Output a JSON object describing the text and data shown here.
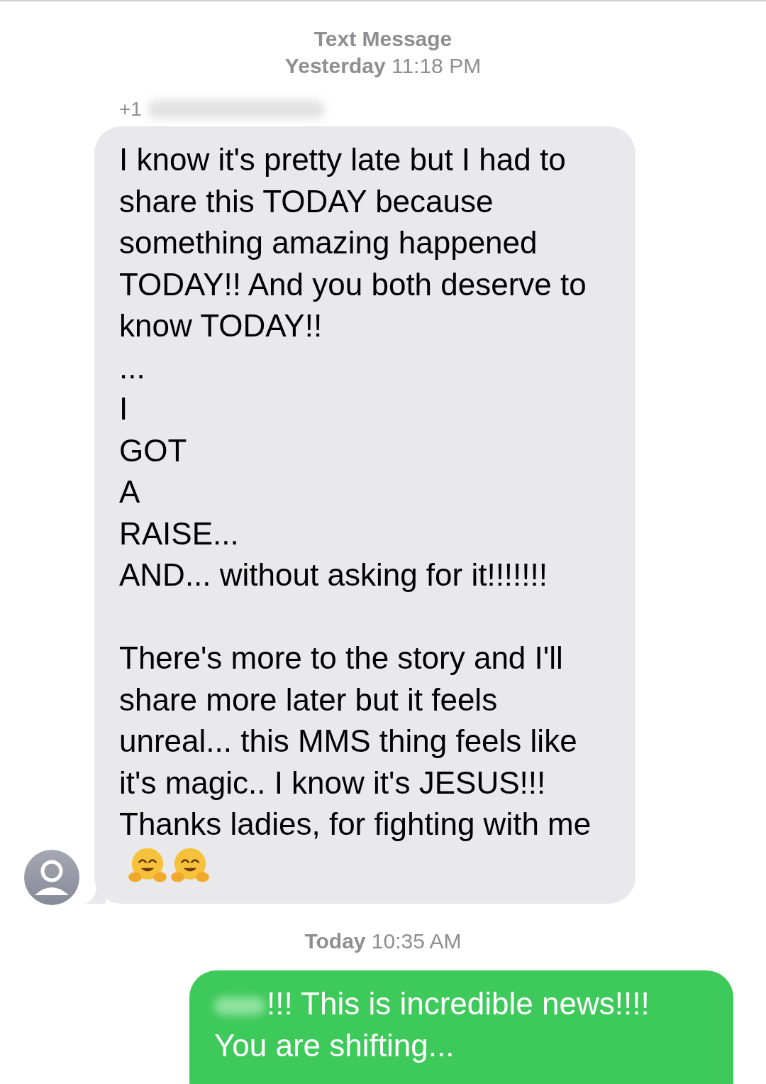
{
  "thread": [
    {
      "kind": "timestamp",
      "label": "Text Message",
      "day": "Yesterday",
      "time": "11:18 PM"
    },
    {
      "kind": "received",
      "sender": "+1",
      "sender_redacted": true,
      "avatar": true,
      "emojis": [
        {
          "kind": "hug"
        },
        {
          "kind": "hug"
        }
      ],
      "text": "I know it's pretty late but I had to share this TODAY because something amazing happened TODAY!! And you both deserve to know TODAY!!\n...\nI\nGOT\nA\nRAISE...\nAND... without asking for it!!!!!!!\n\nThere's more to the story and I'll share more later but it feels unreal... this MMS thing feels like it's magic.. I know it's JESUS!!! Thanks ladies, for fighting with me"
    },
    {
      "kind": "timestamp",
      "day": "Today",
      "time": "10:35 AM"
    },
    {
      "kind": "sent",
      "prefix_redacted": true,
      "text": "!!! This is incredible news!!!! You are shifting..."
    }
  ]
}
